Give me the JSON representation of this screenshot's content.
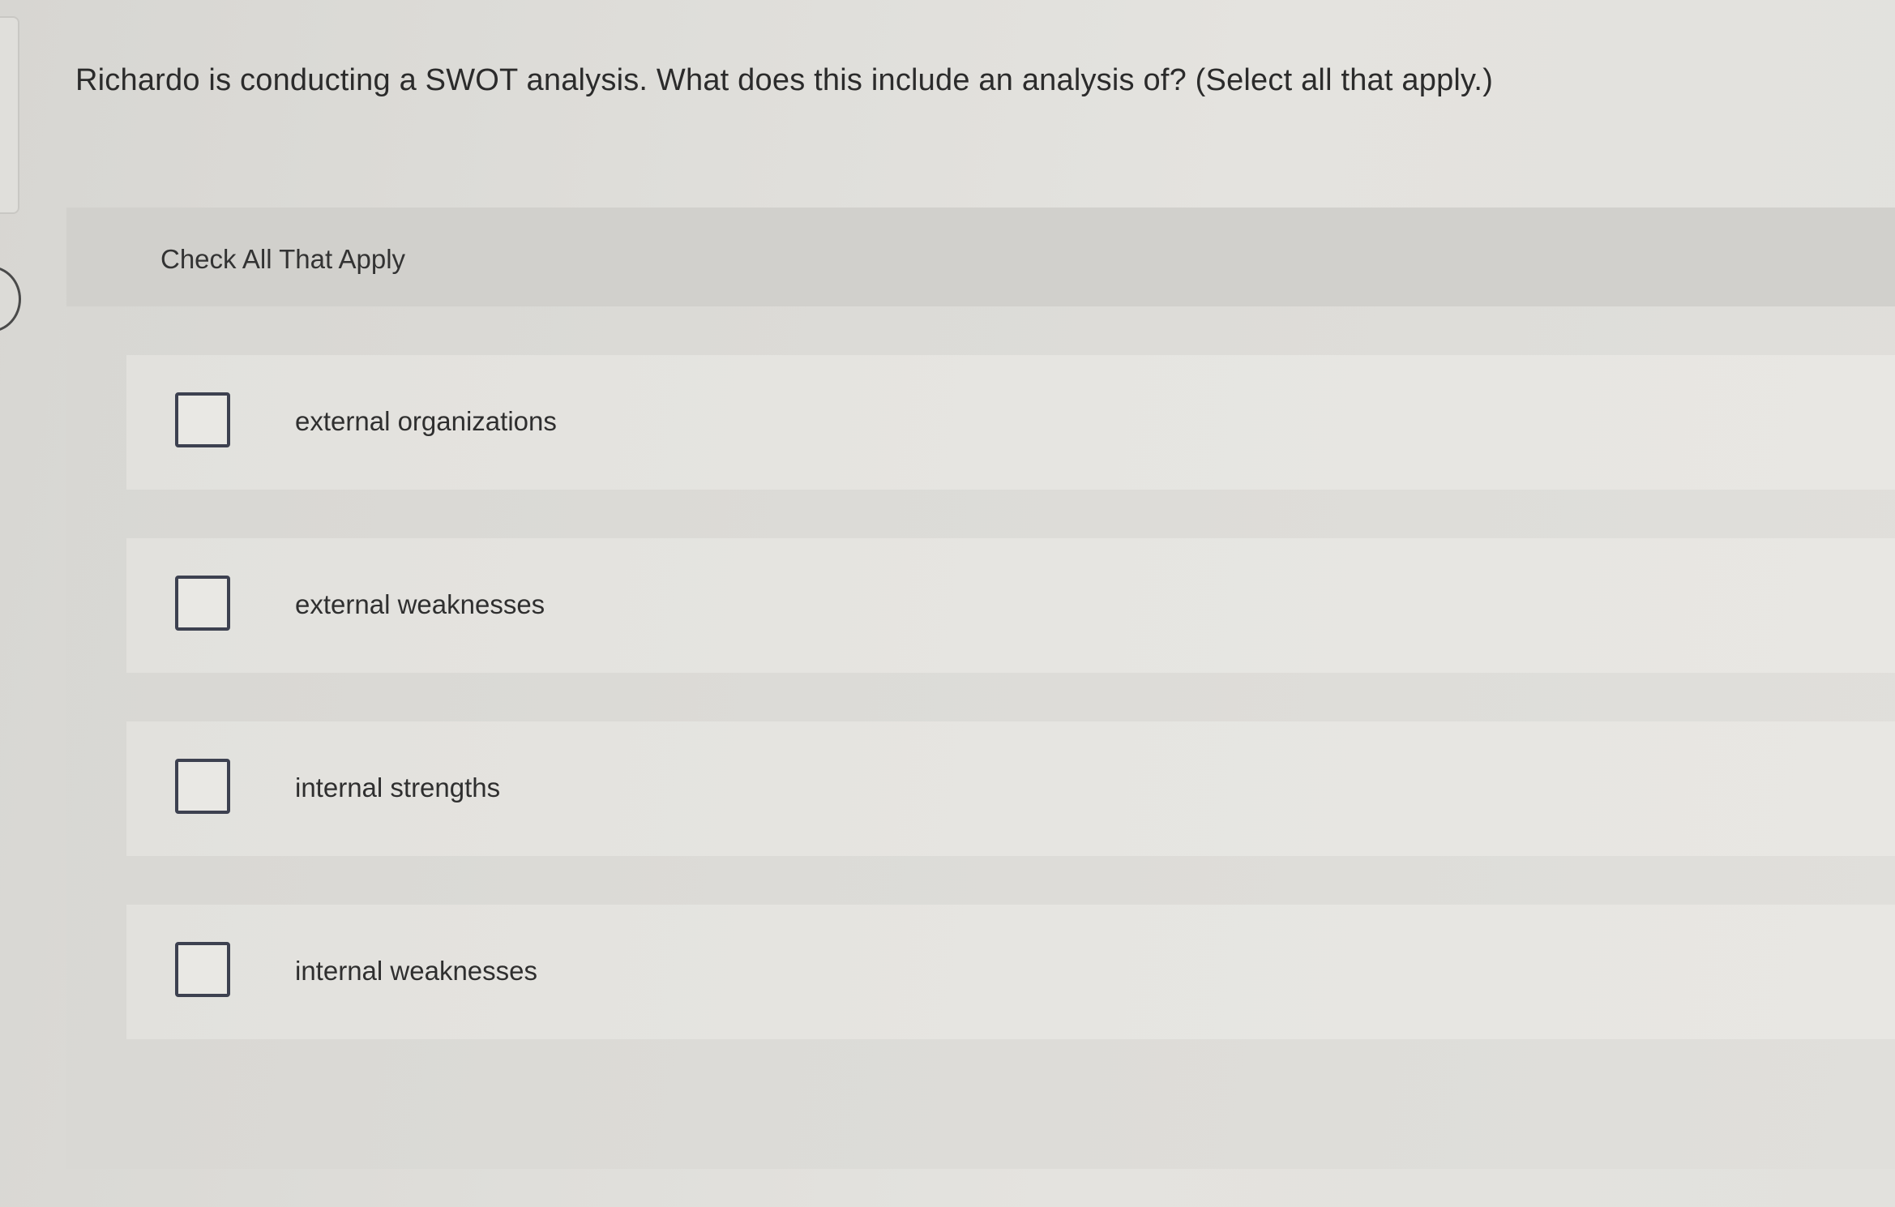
{
  "question": {
    "text": "Richardo is conducting a SWOT analysis. What does this include an analysis of? (Select all that apply.)"
  },
  "answer_panel": {
    "header": "Check All That Apply",
    "options": [
      {
        "label": "external organizations",
        "checked": false
      },
      {
        "label": "external weaknesses",
        "checked": false
      },
      {
        "label": "internal strengths",
        "checked": false
      },
      {
        "label": "internal weaknesses",
        "checked": false
      }
    ]
  },
  "colors": {
    "checkbox_border": "#3d4150",
    "text": "#2b2b2b",
    "panel_header_bg": "#d1d0cc"
  }
}
